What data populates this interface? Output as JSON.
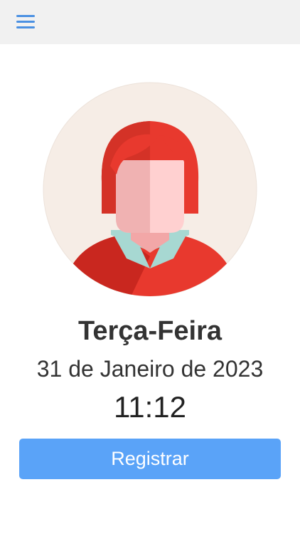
{
  "header": {
    "menu_icon": "hamburger-menu-icon",
    "background": "#f1f1f1",
    "accent": "#4a90e2"
  },
  "profile": {
    "avatar_icon": "user-avatar-icon"
  },
  "clock": {
    "weekday": "Terça-Feira",
    "date": "31 de Janeiro de 2023",
    "time": "11:12"
  },
  "actions": {
    "register_label": "Registrar",
    "register_color": "#5aa3f8"
  }
}
